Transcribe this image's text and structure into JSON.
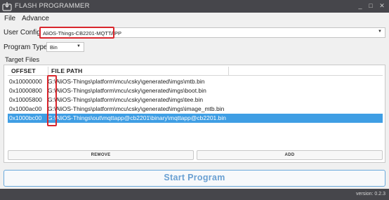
{
  "window": {
    "title": "FLASH PROGRAMMER",
    "minimize": "_",
    "maximize": "□",
    "close": "✕"
  },
  "menu": {
    "file": "File",
    "advance": "Advance"
  },
  "user_config": {
    "label": "User Config:",
    "value": "AliOS-Things-CB2201-MQTTAPP"
  },
  "program_type": {
    "label": "Program Type:",
    "value": "Bin"
  },
  "target_files": {
    "label": "Target Files",
    "columns": {
      "offset": "OFFSET",
      "file_path": "FILE PATH"
    },
    "rows": [
      {
        "offset": "0x10000000",
        "path": "G:\\AliOS-Things\\platform\\mcu\\csky\\generated\\imgs\\mtb.bin"
      },
      {
        "offset": "0x10000800",
        "path": "G:\\AliOS-Things\\platform\\mcu\\csky\\generated\\imgs\\boot.bin"
      },
      {
        "offset": "0x10005800",
        "path": "G:\\AliOS-Things\\platform\\mcu\\csky\\generated\\imgs\\tee.bin"
      },
      {
        "offset": "0x1000ac00",
        "path": "G:\\AliOS-Things\\platform\\mcu\\csky\\generated\\imgs\\image_mtb.bin"
      },
      {
        "offset": "0x1000bc00",
        "path": "G:\\AliOS-Things\\out\\mqttapp@cb2201\\binary\\mqttapp@cb2201.bin"
      }
    ],
    "remove_label": "REMOVE",
    "add_label": "ADD"
  },
  "start_button": "Start Program",
  "status": {
    "version": "version: 0.2.3"
  },
  "colors": {
    "titlebar": "#46464b",
    "selection": "#3f9ee4",
    "highlight": "#d8262c",
    "accent": "#6aa9dc"
  },
  "icons": {
    "app": "chip-download-icon",
    "dropdown": "triangle-down-icon"
  }
}
